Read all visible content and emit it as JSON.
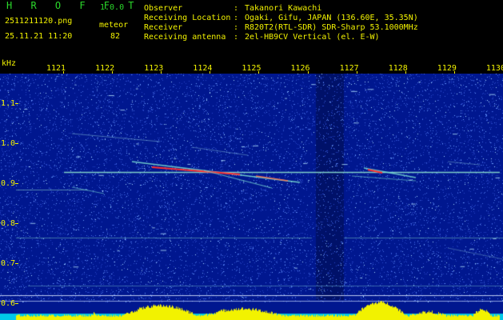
{
  "header": {
    "app_title": "H R O F F T",
    "app_version": "1.0.0",
    "filename": "2511211120.png",
    "timestamp": "25.11.21 11:20",
    "type_label": "meteor",
    "count_value": "82",
    "info": [
      {
        "label": "Observer",
        "value": "Takanori Kawachi"
      },
      {
        "label": "Receiving Location",
        "value": "Ogaki, Gifu, JAPAN (136.60E, 35.35N)"
      },
      {
        "label": "Receiver",
        "value": "R820T2(RTL-SDR) SDR-Sharp 53.1000MHz"
      },
      {
        "label": "Receiving antenna",
        "value": "2el-HB9CV Vertical (el. E-W)"
      }
    ]
  },
  "axes": {
    "y_unit": "kHz",
    "y_ticks": [
      "1.1",
      "1.0",
      "0.9",
      "0.8",
      "0.7",
      "0.6"
    ],
    "x_ticks": [
      "1121",
      "1122",
      "1123",
      "1124",
      "1125",
      "1126",
      "1127",
      "1128",
      "1129",
      "1130"
    ]
  },
  "colors": {
    "background": "#00178f",
    "label_yellow": "#f2f200",
    "title_green": "#2bd92b",
    "carrier_line": "#7fd0c8",
    "echo_hot": "#ff3030",
    "activity_bar": "#f2f200"
  }
}
